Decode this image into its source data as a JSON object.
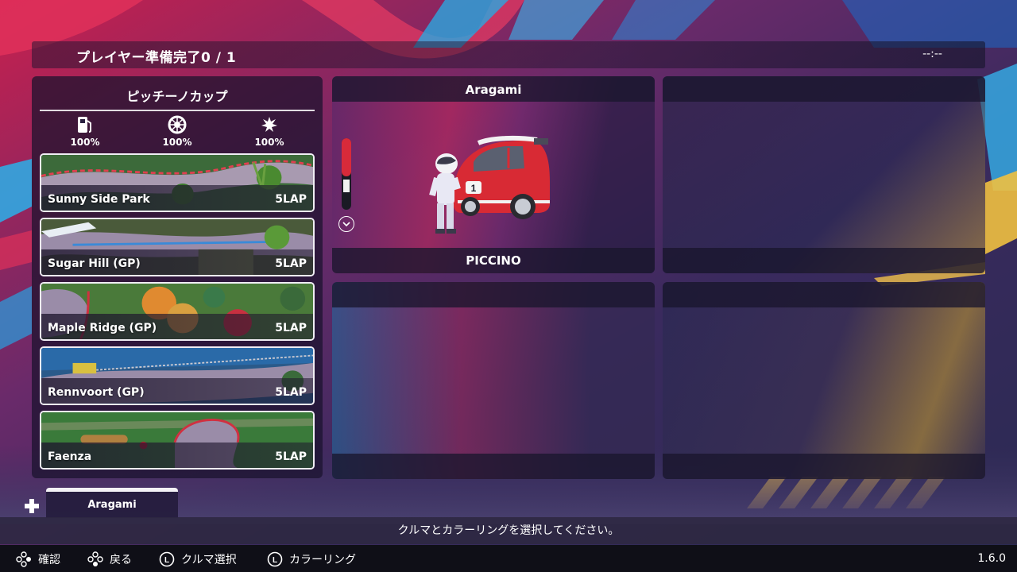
{
  "header": {
    "title": "プレイヤー準備完了0 / 1",
    "timer": "--:--"
  },
  "cup": {
    "title": "ピッチーノカップ",
    "stats": [
      {
        "icon": "fuel-icon",
        "value": "100%"
      },
      {
        "icon": "tire-icon",
        "value": "100%"
      },
      {
        "icon": "damage-icon",
        "value": "100%"
      }
    ],
    "tracks": [
      {
        "name": "Sunny Side Park",
        "laps": "5LAP"
      },
      {
        "name": "Sugar Hill (GP)",
        "laps": "5LAP"
      },
      {
        "name": "Maple Ridge (GP)",
        "laps": "5LAP"
      },
      {
        "name": "Rennvoort (GP)",
        "laps": "5LAP"
      },
      {
        "name": "Faenza",
        "laps": "5LAP"
      }
    ]
  },
  "slots": [
    {
      "player": "Aragami",
      "car": "PICCINO",
      "car_number": "1"
    },
    {
      "player": "",
      "car": ""
    },
    {
      "player": "",
      "car": ""
    },
    {
      "player": "",
      "car": ""
    }
  ],
  "tabs": [
    {
      "label": "Aragami",
      "active": true
    }
  ],
  "message": "クルマとカラーリングを選択してください。",
  "controls": [
    {
      "icon": "button-a-icon",
      "label": "確認"
    },
    {
      "icon": "button-b-icon",
      "label": "戻る"
    },
    {
      "icon": "l-stick-icon",
      "label": "クルマ選択"
    },
    {
      "icon": "l-stick-icon",
      "label": "カラーリング"
    }
  ],
  "version": "1.6.0",
  "colors": {
    "accent_red": "#d8283a",
    "panel_dark": "#1f1830",
    "teal": "#2aa8d8",
    "yellow": "#e8b840"
  }
}
